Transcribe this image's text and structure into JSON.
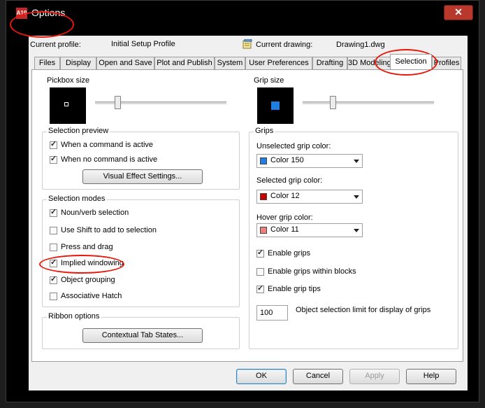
{
  "window": {
    "title": "Options",
    "icon_label": "A10",
    "close_symbol": "✕"
  },
  "profile": {
    "current_profile_label": "Current profile:",
    "current_profile_value": "Initial Setup Profile",
    "current_drawing_label": "Current drawing:",
    "current_drawing_value": "Drawing1.dwg"
  },
  "tabs": [
    {
      "label": "Files"
    },
    {
      "label": "Display"
    },
    {
      "label": "Open and Save"
    },
    {
      "label": "Plot and Publish"
    },
    {
      "label": "System"
    },
    {
      "label": "User Preferences"
    },
    {
      "label": "Drafting"
    },
    {
      "label": "3D Modeling"
    },
    {
      "label": "Selection"
    },
    {
      "label": "Profiles"
    }
  ],
  "pickbox": {
    "title": "Pickbox size"
  },
  "gripsize": {
    "title": "Grip size"
  },
  "selection_preview": {
    "title": "Selection preview",
    "when_active": "When a command is active",
    "when_no_command": "When no command is active",
    "visual_effect_button": "Visual Effect Settings..."
  },
  "selection_modes": {
    "title": "Selection modes",
    "noun_verb": "Noun/verb selection",
    "use_shift": "Use Shift to add to selection",
    "press_drag": "Press and drag",
    "implied_windowing": "Implied windowing",
    "object_grouping": "Object grouping",
    "associative_hatch": "Associative Hatch"
  },
  "ribbon_options": {
    "title": "Ribbon options",
    "contextual_button": "Contextual Tab States..."
  },
  "grips": {
    "title": "Grips",
    "unselected_label": "Unselected grip color:",
    "unselected_value": "Color 150",
    "selected_label": "Selected grip color:",
    "selected_value": "Color 12",
    "hover_label": "Hover grip color:",
    "hover_value": "Color 11",
    "enable_grips": "Enable grips",
    "enable_within_blocks": "Enable grips within blocks",
    "enable_tips": "Enable grip tips",
    "limit_value": "100",
    "limit_label": "Object selection limit for display of grips"
  },
  "buttons": {
    "ok": "OK",
    "cancel": "Cancel",
    "apply": "Apply",
    "help": "Help"
  },
  "colors": {
    "color_150": "#1e7fe0",
    "color_12": "#c80000",
    "color_11": "#f08080",
    "annotation": "#e8170a"
  }
}
